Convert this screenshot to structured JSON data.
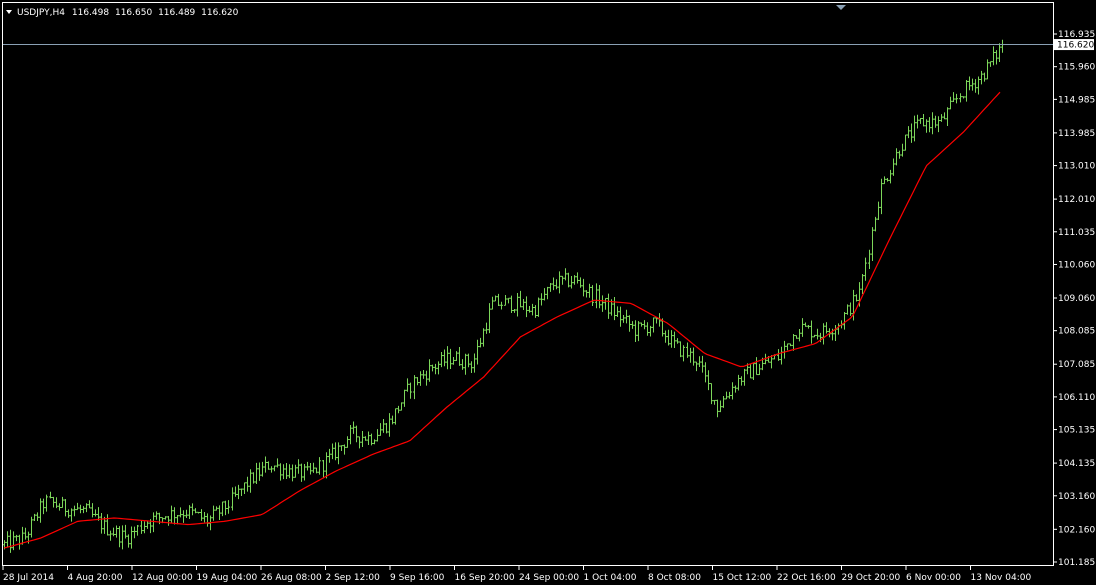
{
  "chart_data": {
    "type": "ohlc",
    "symbol": "USDJPY",
    "timeframe": "H4",
    "ohlc_display": [
      "116.498",
      "116.650",
      "116.489",
      "116.620"
    ],
    "current_price": 116.62,
    "current_price_label": "116.620",
    "ylim": [
      101.185,
      116.935
    ],
    "y_ticks": [
      101.185,
      102.16,
      103.16,
      104.135,
      105.135,
      106.11,
      107.085,
      108.085,
      109.06,
      110.06,
      111.035,
      112.01,
      113.01,
      113.985,
      114.985,
      115.96,
      116.935
    ],
    "y_tick_labels": [
      "101.185",
      "102.160",
      "103.160",
      "104.135",
      "105.135",
      "106.110",
      "107.085",
      "108.085",
      "109.060",
      "110.060",
      "111.035",
      "112.010",
      "113.010",
      "113.985",
      "114.985",
      "115.960",
      "116.935"
    ],
    "x_tick_labels": [
      "28 Jul 2014",
      "4 Aug 20:00",
      "12 Aug 00:00",
      "19 Aug 04:00",
      "26 Aug 08:00",
      "2 Sep 12:00",
      "9 Sep 16:00",
      "16 Sep 20:00",
      "24 Sep 00:00",
      "1 Oct 04:00",
      "8 Oct 08:00",
      "15 Oct 12:00",
      "22 Oct 16:00",
      "29 Oct 20:00",
      "6 Nov 00:00",
      "13 Nov 04:00"
    ],
    "price_anchor_closes": [
      101.7,
      101.9,
      103.0,
      102.8,
      102.7,
      102.2,
      101.9,
      102.4,
      102.6,
      102.7,
      102.4,
      102.9,
      103.6,
      104.1,
      103.9,
      103.8,
      104.3,
      105.0,
      104.9,
      105.4,
      106.5,
      107.0,
      107.3,
      107.1,
      108.9,
      108.9,
      108.7,
      109.5,
      109.6,
      109.1,
      108.6,
      108.1,
      108.3,
      107.6,
      107.2,
      105.8,
      106.6,
      107.0,
      107.3,
      108.2,
      108.0,
      108.3,
      109.2,
      112.3,
      113.6,
      114.3,
      114.3,
      115.2,
      115.7,
      116.6
    ],
    "moving_average": {
      "color": "#ff0000",
      "anchors": [
        101.6,
        101.9,
        102.4,
        102.5,
        102.4,
        102.3,
        102.4,
        102.6,
        103.3,
        103.9,
        104.4,
        104.8,
        105.8,
        106.7,
        107.9,
        108.5,
        109.0,
        108.9,
        108.3,
        107.4,
        107.0,
        107.4,
        107.7,
        108.5,
        110.8,
        113.0,
        114.0,
        115.2
      ]
    },
    "bar_color": "#7cd65a",
    "grid": false
  }
}
